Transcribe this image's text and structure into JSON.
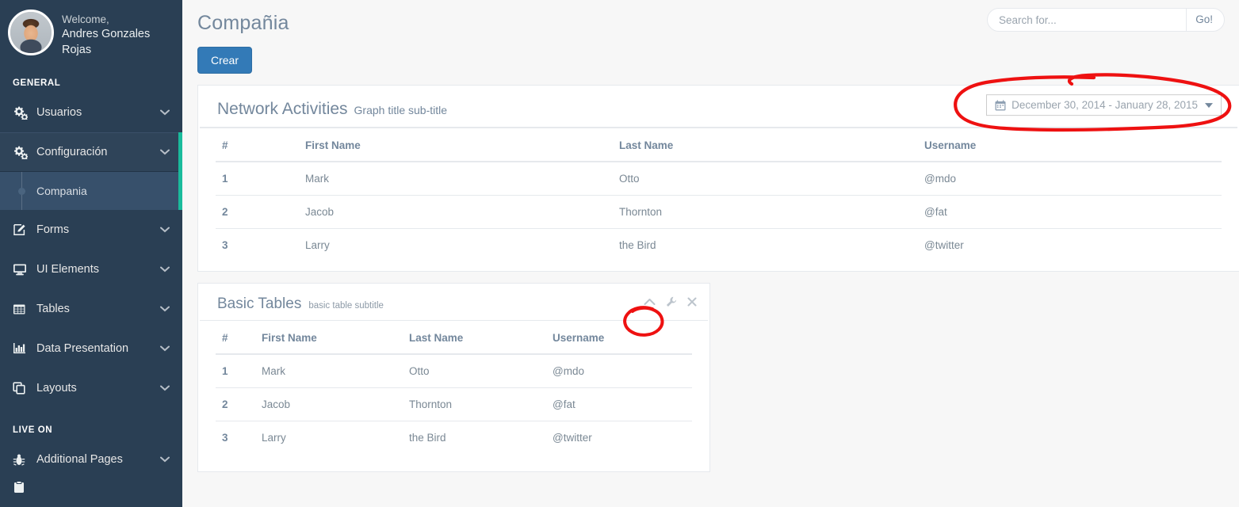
{
  "sidebar": {
    "profile": {
      "greeting": "Welcome,",
      "name": "Andres Gonzales Rojas"
    },
    "sections": [
      {
        "title": "GENERAL"
      },
      {
        "title": "LIVE ON"
      }
    ],
    "items": [
      {
        "label": "Usuarios",
        "icon": "gears-icon",
        "active": false
      },
      {
        "label": "Configuración",
        "icon": "gears-icon",
        "active": true
      },
      {
        "label": "Forms",
        "icon": "edit-square-icon",
        "active": false
      },
      {
        "label": "UI Elements",
        "icon": "desktop-icon",
        "active": false
      },
      {
        "label": "Tables",
        "icon": "table-grid-icon",
        "active": false
      },
      {
        "label": "Data Presentation",
        "icon": "bar-chart-icon",
        "active": false
      },
      {
        "label": "Layouts",
        "icon": "clone-icon",
        "active": false
      }
    ],
    "sub_items": [
      {
        "label": "Compania",
        "active": true
      }
    ],
    "live_items": [
      {
        "label": "Additional Pages",
        "icon": "bug-icon"
      }
    ]
  },
  "header": {
    "page_title": "Compañia",
    "search": {
      "placeholder": "Search for...",
      "value": "",
      "go_label": "Go!"
    }
  },
  "toolbar": {
    "create_label": "Crear"
  },
  "panels": [
    {
      "title": "Network Activities",
      "subtitle": "Graph title sub-title",
      "daterange": {
        "value": "December 30, 2014 - January 28, 2015",
        "icon": "calendar-icon"
      },
      "table": {
        "columns": [
          "#",
          "First Name",
          "Last Name",
          "Username"
        ],
        "rows": [
          [
            "1",
            "Mark",
            "Otto",
            "@mdo"
          ],
          [
            "2",
            "Jacob",
            "Thornton",
            "@fat"
          ],
          [
            "3",
            "Larry",
            "the Bird",
            "@twitter"
          ]
        ]
      }
    },
    {
      "title": "Basic Tables",
      "subtitle": "basic table subtitle",
      "tools": [
        {
          "name": "collapse-icon",
          "glyph": "chevron-up"
        },
        {
          "name": "settings-wrench-icon",
          "glyph": "wrench"
        },
        {
          "name": "close-icon",
          "glyph": "times"
        }
      ],
      "table": {
        "columns": [
          "#",
          "First Name",
          "Last Name",
          "Username"
        ],
        "rows": [
          [
            "1",
            "Mark",
            "Otto",
            "@mdo"
          ],
          [
            "2",
            "Jacob",
            "Thornton",
            "@fat"
          ],
          [
            "3",
            "Larry",
            "the Bird",
            "@twitter"
          ]
        ]
      }
    }
  ],
  "annotations": [
    {
      "name": "date-range-highlight",
      "shape": "hand-drawn-oval",
      "color": "#EE1111",
      "target": "date-range-picker"
    },
    {
      "name": "collapse-icon-highlight",
      "shape": "hand-drawn-circle",
      "color": "#EE1111",
      "target": "collapse-icon"
    }
  ],
  "colors": {
    "sidebar_bg": "#2A3F54",
    "sidebar_active": "#2F4459",
    "accent_teal": "#1ABB9C",
    "primary_blue": "#337AB7",
    "text_muted": "#73879C",
    "content_bg": "#F7F7F7",
    "annotation_red": "#EE1111"
  }
}
